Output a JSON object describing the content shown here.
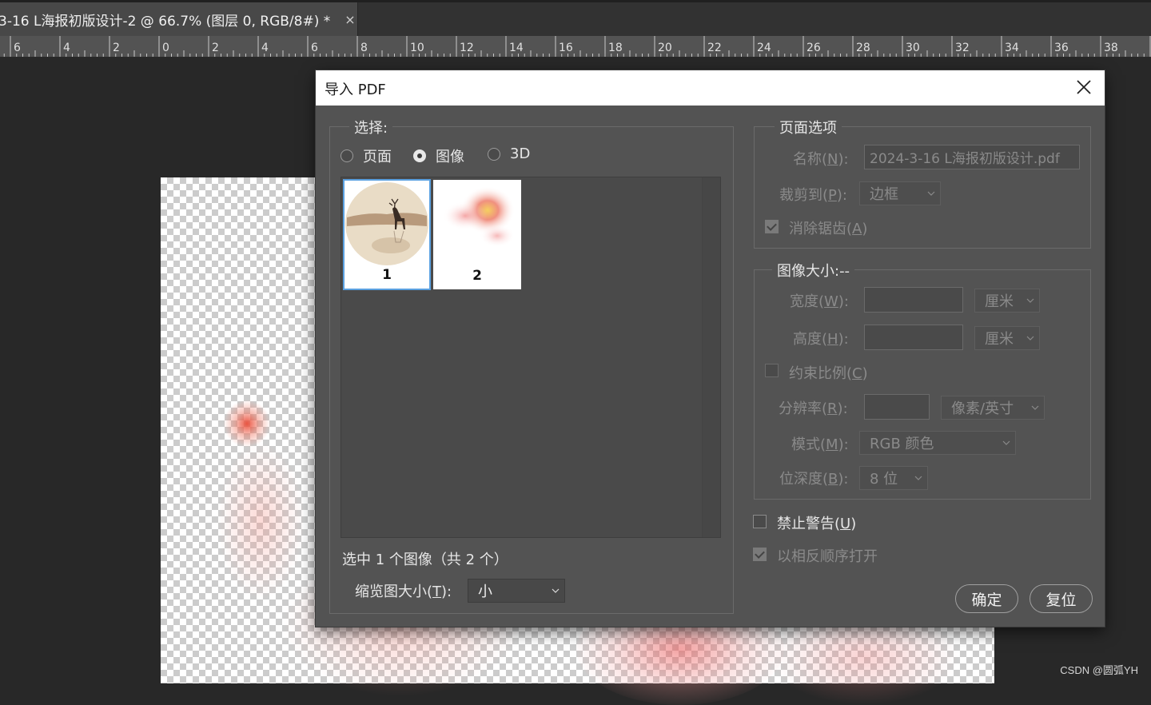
{
  "document_tab": {
    "title": "3-16 L海报初版设计-2 @ 66.7% (图层 0, RGB/8#) *",
    "close": "×"
  },
  "ruler": {
    "labels": [
      "6",
      "4",
      "2",
      "0",
      "2",
      "4",
      "6",
      "8",
      "10",
      "12",
      "14",
      "16",
      "18",
      "20",
      "22",
      "24",
      "26",
      "28",
      "30",
      "32",
      "34",
      "36",
      "38"
    ]
  },
  "dialog": {
    "title": "导入 PDF",
    "select_group": {
      "label": "选择:",
      "radios": [
        {
          "label": "页面",
          "selected": false
        },
        {
          "label": "图像",
          "selected": true
        },
        {
          "label": "3D",
          "selected": false
        }
      ],
      "thumbnails": [
        {
          "label": "1",
          "selected": true
        },
        {
          "label": "2",
          "selected": false
        }
      ],
      "status": "选中 1 个图像（共 2 个）",
      "thumb_size_label": "缩览图大小(",
      "thumb_size_key": "T",
      "thumb_size_suffix": "):",
      "thumb_size_value": "小"
    },
    "page_options": {
      "label": "页面选项",
      "name_label": "名称(",
      "name_key": "N",
      "name_suffix": "):",
      "name_value": "2024-3-16 L海报初版设计.pdf",
      "crop_label": "裁剪到(",
      "crop_key": "P",
      "crop_suffix": "):",
      "crop_value": "边框",
      "antialias_label": "消除锯齿(",
      "antialias_key": "A",
      "antialias_suffix": ")",
      "antialias_checked": true
    },
    "image_size": {
      "label": "图像大小:--",
      "width_label": "宽度(",
      "width_key": "W",
      "width_suffix": "):",
      "width_unit": "厘米",
      "height_label": "高度(",
      "height_key": "H",
      "height_suffix": "):",
      "height_unit": "厘米",
      "constrain_label": "约束比例(",
      "constrain_key": "C",
      "constrain_suffix": ")",
      "resolution_label": "分辨率(",
      "resolution_key": "R",
      "resolution_suffix": "):",
      "resolution_unit": "像素/英寸",
      "mode_label": "模式(",
      "mode_key": "M",
      "mode_suffix": "):",
      "mode_value": "RGB 颜色",
      "depth_label": "位深度(",
      "depth_key": "B",
      "depth_suffix": "):",
      "depth_value": "8 位"
    },
    "suppress_warnings": {
      "label": "禁止警告(",
      "key": "U",
      "suffix": ")",
      "checked": false
    },
    "reverse_order": {
      "label": "以相反顺序打开",
      "checked": true
    },
    "ok_button": "确定",
    "reset_button": "复位"
  },
  "watermark": "CSDN @圆弧YH"
}
